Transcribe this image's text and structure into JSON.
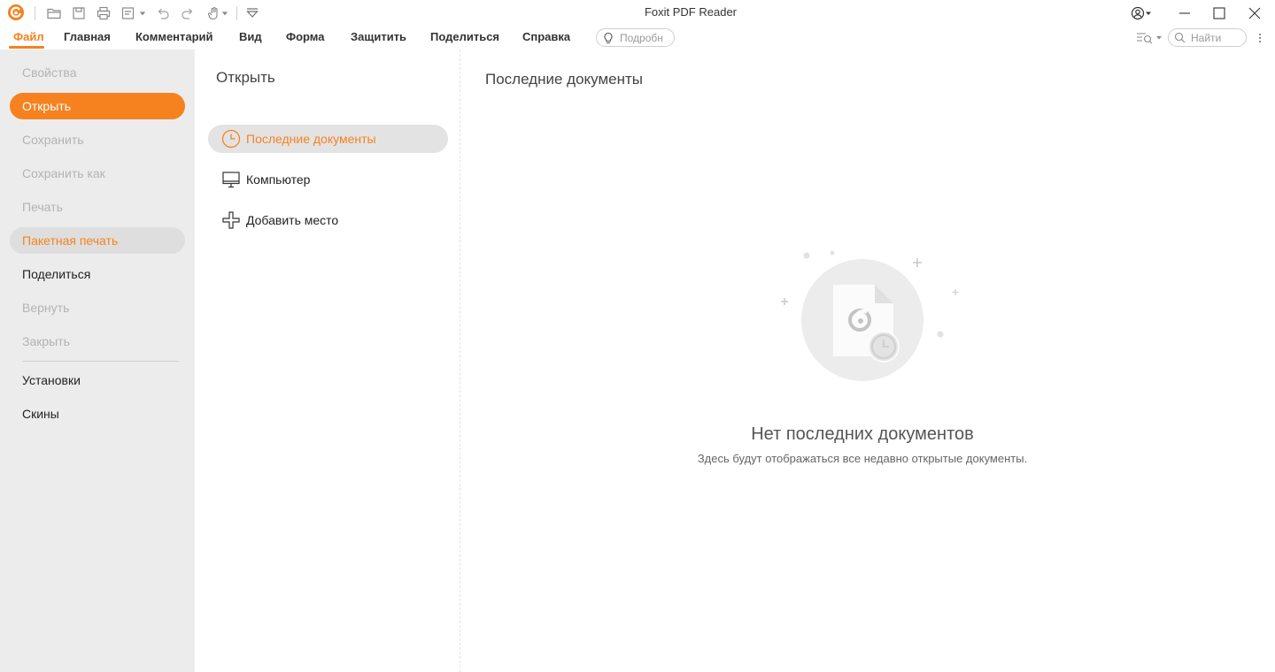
{
  "app": {
    "title": "Foxit PDF Reader",
    "accent_color": "#f5821f"
  },
  "quick_access": {
    "icons": [
      "foxit-logo-icon",
      "open-folder-icon",
      "save-icon",
      "print-icon",
      "save-as-icon",
      "undo-icon",
      "redo-icon",
      "hand-tool-icon",
      "customize-toolbar-icon"
    ]
  },
  "menubar": {
    "items": [
      {
        "label": "Файл",
        "active": true
      },
      {
        "label": "Главная"
      },
      {
        "label": "Комментарий"
      },
      {
        "label": "Вид"
      },
      {
        "label": "Форма"
      },
      {
        "label": "Защитить"
      },
      {
        "label": "Поделиться"
      },
      {
        "label": "Справка"
      }
    ],
    "tell_me_placeholder": "Подробн",
    "search_placeholder": "Найти"
  },
  "leftnav": {
    "items": [
      {
        "label": "Свойства",
        "state": "disabled"
      },
      {
        "label": "Открыть",
        "state": "selected"
      },
      {
        "label": "Сохранить",
        "state": "disabled"
      },
      {
        "label": "Сохранить как",
        "state": "disabled"
      },
      {
        "label": "Печать",
        "state": "disabled"
      },
      {
        "label": "Пакетная печать",
        "state": "hover"
      },
      {
        "label": "Поделиться",
        "state": "enabled"
      },
      {
        "label": "Вернуть",
        "state": "disabled"
      },
      {
        "label": "Закрыть",
        "state": "disabled"
      },
      {
        "label": "Установки",
        "state": "enabled"
      },
      {
        "label": "Скины",
        "state": "enabled"
      }
    ]
  },
  "open_panel": {
    "title": "Открыть",
    "items": [
      {
        "label": "Последние документы",
        "icon": "clock-icon",
        "selected": true
      },
      {
        "label": "Компьютер",
        "icon": "computer-icon"
      },
      {
        "label": "Добавить место",
        "icon": "add-place-icon"
      }
    ]
  },
  "recent": {
    "title": "Последние документы",
    "empty_title": "Нет последних документов",
    "empty_subtitle": "Здесь будут отображаться все недавно открытые документы."
  }
}
